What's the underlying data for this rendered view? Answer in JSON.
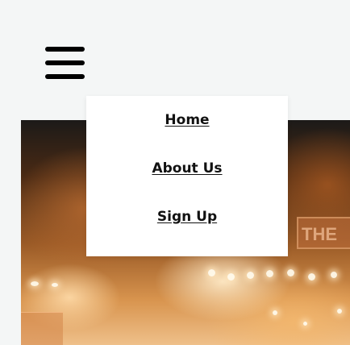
{
  "menu_toggle": {
    "icon": "hamburger-menu-icon"
  },
  "nav_menu": {
    "items": [
      {
        "label": "Home"
      },
      {
        "label": "About Us"
      },
      {
        "label": "Sign Up"
      }
    ]
  },
  "hero": {
    "sign_text": "THE"
  },
  "colors": {
    "page_background": "#f4f6f6",
    "menu_background": "#ffffff",
    "text": "#111111",
    "icon": "#000000"
  }
}
